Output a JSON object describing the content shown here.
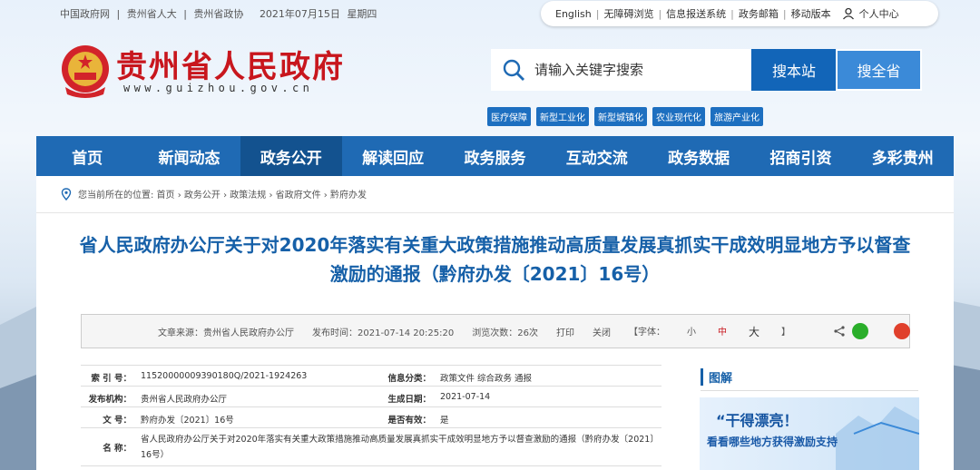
{
  "top_links": [
    "中国政府网",
    "|",
    "贵州省人大",
    "|",
    "贵州省政协",
    "2021年07月15日",
    "星期四"
  ],
  "topbar": {
    "items": [
      "English",
      "无障碍浏览",
      "信息报送系统",
      "政务邮箱",
      "移动版本"
    ],
    "personal": "个人中心"
  },
  "site": {
    "title": "贵州省人民政府",
    "url": "www.guizhou.gov.cn"
  },
  "search": {
    "placeholder": "请输入关键字搜索",
    "btn_site": "搜本站",
    "btn_province": "搜全省"
  },
  "tags": [
    "医疗保障",
    "新型工业化",
    "新型城镇化",
    "农业现代化",
    "旅游产业化"
  ],
  "nav": [
    "首页",
    "新闻动态",
    "政务公开",
    "解读回应",
    "政务服务",
    "互动交流",
    "政务数据",
    "招商引资",
    "多彩贵州"
  ],
  "breadcrumb": "您当前所在的位置: 首页 › 政务公开 › 政策法规 › 省政府文件 › 黔府办发",
  "headline": "省人民政府办公厅关于对2020年落实有关重大政策措施推动高质量发展真抓实干成效明显地方予以督查激励的通报（黔府办发〔2021〕16号）",
  "meta": {
    "source": "文章来源：贵州省人民政府办公厅",
    "time": "发布时间：2021-07-14 20:25:20",
    "views": "浏览次数：26次",
    "print": "打印",
    "close": "关闭",
    "font_label": "【字体：",
    "font_small": "小",
    "font_mid": "中",
    "font_large": "大",
    "font_end": "】"
  },
  "info": {
    "r1": {
      "k1": "索 引 号：",
      "v1": "11520000009390180Q/2021-1924263",
      "k2": "信息分类：",
      "v2": "政策文件    综合政务    通报"
    },
    "r2": {
      "k1": "发布机构：",
      "v1": "贵州省人民政府办公厅",
      "k2": "生成日期：",
      "v2": "2021-07-14"
    },
    "r3": {
      "k1": "文    号：",
      "v1": "黔府办发〔2021〕16号",
      "k2": "是否有效：",
      "v2": "是"
    },
    "r4": {
      "k1": "名    称：",
      "v1": "省人民政府办公厅关于对2020年落实有关重大政策措施推动高质量发展真抓实干成效明显地方予以督查激励的通报（黔府办发〔2021〕16号）"
    }
  },
  "side": {
    "title": "图解",
    "b1": "“干得漂亮！",
    "b2": "看看哪些地方获得激励支持"
  },
  "colors": {
    "nav": "#1f6ab4",
    "nav_active": "#13528f",
    "title_red": "#c8161d",
    "headline_blue": "#1660a8"
  }
}
